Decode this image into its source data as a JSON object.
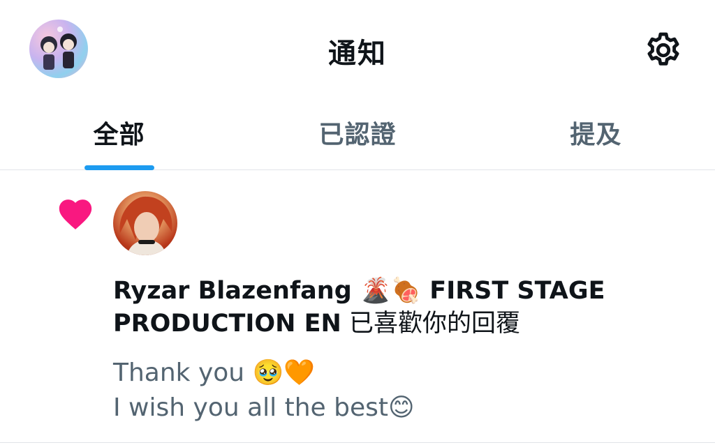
{
  "header": {
    "title": "通知",
    "profile_avatar": "profile-avatar",
    "settings_icon": "gear-icon"
  },
  "tabs": [
    {
      "label": "全部",
      "active": true
    },
    {
      "label": "已認證",
      "active": false
    },
    {
      "label": "提及",
      "active": false
    }
  ],
  "notification": {
    "type_icon": "heart-icon",
    "actor_name": "Ryzar Blazenfang 🌋🍖 FIRST STAGE PRODUCTION EN",
    "action_text": " 已喜歡你的回覆",
    "reply_lines": [
      "Thank you 🥹🧡",
      "I wish you all the best😊"
    ]
  },
  "colors": {
    "accent": "#1d9bf0",
    "heart": "#f91880",
    "primary_text": "#0f1419",
    "secondary_text": "#536471",
    "divider": "#e1e4e8"
  }
}
